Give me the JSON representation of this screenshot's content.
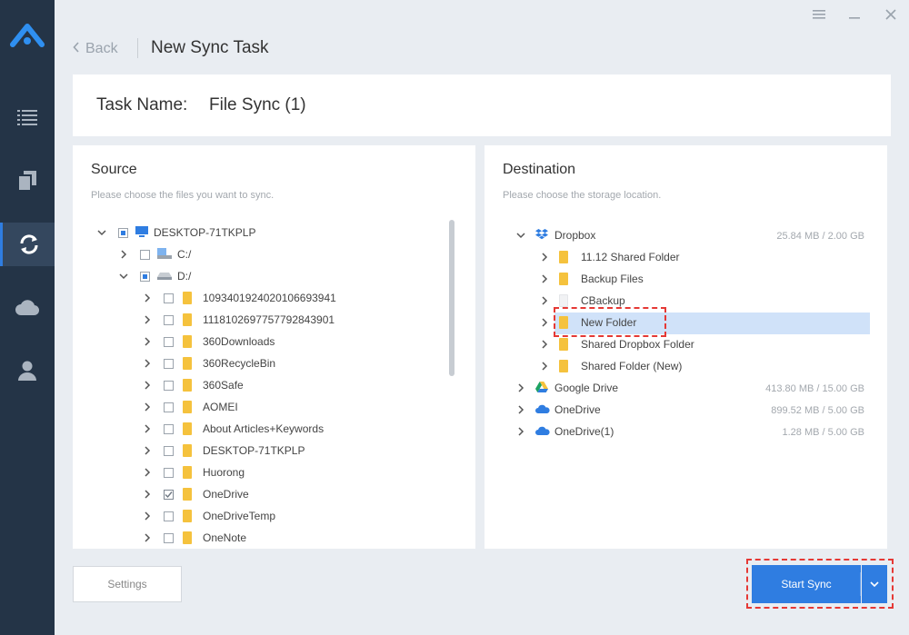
{
  "header": {
    "back_label": "Back",
    "title": "New Sync Task"
  },
  "task": {
    "label": "Task Name:",
    "value": "File Sync (1)"
  },
  "sidebar": {
    "items": [
      {
        "icon": "list-icon"
      },
      {
        "icon": "copy-icon"
      },
      {
        "icon": "sync-icon",
        "active": true
      },
      {
        "icon": "cloud-icon"
      },
      {
        "icon": "user-icon"
      }
    ]
  },
  "source": {
    "title": "Source",
    "subtitle": "Please choose the files you want to sync.",
    "root": "DESKTOP-71TKPLP",
    "drive_c": "C:/",
    "drive_d": "D:/",
    "folders": [
      "1093401924020106693941",
      "1118102697757792843901",
      "360Downloads",
      "360RecycleBin",
      "360Safe",
      "AOMEI",
      "About Articles+Keywords",
      "DESKTOP-71TKPLP",
      "Huorong",
      "OneDrive",
      "OneDriveTemp",
      "OneNote"
    ]
  },
  "destination": {
    "title": "Destination",
    "subtitle": "Please choose the storage location.",
    "dropbox": {
      "name": "Dropbox",
      "size": "25.84 MB / 2.00 GB"
    },
    "dropbox_folders": [
      "11.12 Shared Folder",
      "Backup Files",
      "CBackup",
      "New Folder",
      "Shared Dropbox Folder",
      "Shared Folder (New)"
    ],
    "google_drive": {
      "name": "Google Drive",
      "size": "413.80 MB / 15.00 GB"
    },
    "onedrive": {
      "name": "OneDrive",
      "size": "899.52 MB / 5.00 GB"
    },
    "onedrive1": {
      "name": "OneDrive(1)",
      "size": "1.28 MB / 5.00 GB"
    }
  },
  "footer": {
    "settings_label": "Settings",
    "start_label": "Start Sync"
  },
  "colors": {
    "accent": "#2f7de1",
    "sidebar": "#243447",
    "highlight": "#e53935"
  }
}
